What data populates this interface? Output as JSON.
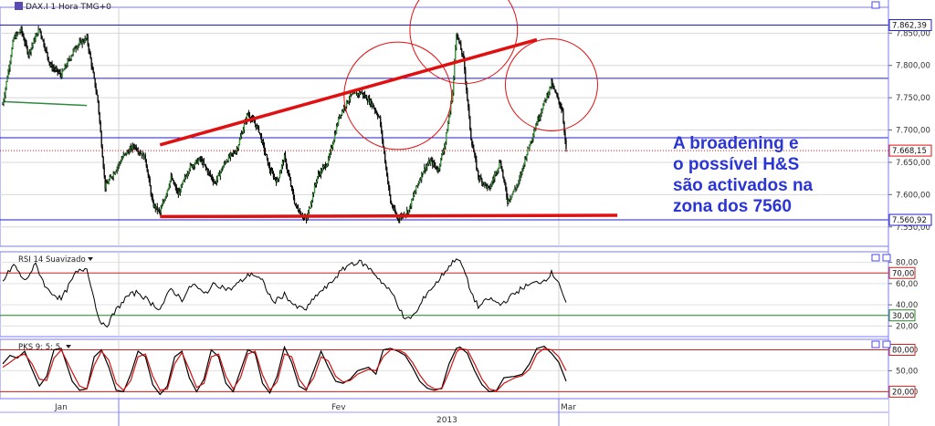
{
  "header": {
    "symbol_title": "DAX.I 1 Hora TMG+0",
    "rsi_title": "RSI 14 Suavizado",
    "pks_title": "PKS 9; 5; 5"
  },
  "annotation": {
    "lines": [
      "A broadening e",
      "o possível H&S",
      "são activados na",
      "zona dos 7560"
    ]
  },
  "colors": {
    "price": "#000000",
    "hline": "#1f1fcf",
    "trend": "#e01010",
    "current": "#e01010",
    "rsi_upper": "#cc2020",
    "rsi_lower": "#1a8a1a",
    "stoch_signal": "#d01010",
    "ma": "#2e8b3e",
    "annotation": "#2b35d6"
  },
  "chart_data": [
    {
      "type": "line",
      "title": "DAX.I 1 Hora TMG+0",
      "ylim": [
        7520,
        7890
      ],
      "yticks": [
        "7.850,00",
        "7.800,00",
        "7.750,00",
        "7.700,00",
        "7.650,00",
        "7.600,00",
        "7.550,00"
      ],
      "price_labels": [
        "7.862,39",
        "7.668,15",
        "7.560,92"
      ],
      "levels": [
        7862.39,
        7780,
        7688,
        7560.92
      ],
      "current": 7668.15,
      "x_labels": [
        "Jan",
        "Fev",
        "Mar"
      ],
      "year_label": "2013",
      "pivots": [
        [
          0,
          7740
        ],
        [
          3,
          7842
        ],
        [
          5,
          7855
        ],
        [
          7,
          7818
        ],
        [
          10,
          7857
        ],
        [
          13,
          7800
        ],
        [
          16,
          7785
        ],
        [
          20,
          7830
        ],
        [
          23,
          7842
        ],
        [
          26,
          7745
        ],
        [
          28,
          7612
        ],
        [
          31,
          7640
        ],
        [
          33,
          7660
        ],
        [
          36,
          7676
        ],
        [
          39,
          7656
        ],
        [
          41,
          7585
        ],
        [
          43,
          7572
        ],
        [
          46,
          7626
        ],
        [
          48,
          7600
        ],
        [
          51,
          7642
        ],
        [
          54,
          7655
        ],
        [
          58,
          7618
        ],
        [
          61,
          7652
        ],
        [
          64,
          7670
        ],
        [
          67,
          7726
        ],
        [
          70,
          7700
        ],
        [
          73,
          7638
        ],
        [
          75,
          7620
        ],
        [
          77,
          7658
        ],
        [
          80,
          7583
        ],
        [
          83,
          7560
        ],
        [
          86,
          7628
        ],
        [
          89,
          7652
        ],
        [
          92,
          7722
        ],
        [
          95,
          7752
        ],
        [
          98,
          7758
        ],
        [
          101,
          7740
        ],
        [
          103,
          7718
        ],
        [
          106,
          7588
        ],
        [
          108,
          7562
        ],
        [
          111,
          7576
        ],
        [
          113,
          7610
        ],
        [
          115,
          7638
        ],
        [
          117,
          7652
        ],
        [
          119,
          7638
        ],
        [
          121,
          7682
        ],
        [
          123,
          7758
        ],
        [
          124,
          7852
        ],
        [
          126,
          7808
        ],
        [
          128,
          7688
        ],
        [
          130,
          7628
        ],
        [
          133,
          7608
        ],
        [
          136,
          7652
        ],
        [
          138,
          7590
        ],
        [
          141,
          7618
        ],
        [
          143,
          7660
        ],
        [
          146,
          7712
        ],
        [
          148,
          7742
        ],
        [
          150,
          7772
        ],
        [
          151,
          7758
        ],
        [
          153,
          7730
        ],
        [
          154,
          7668
        ]
      ],
      "ma_segment": [
        [
          0,
          7744
        ],
        [
          16,
          7738
        ]
      ],
      "trendlines": [
        [
          [
            43,
            7677
          ],
          [
            146,
            7840
          ]
        ],
        [
          [
            43,
            7566
          ],
          [
            168,
            7568
          ]
        ]
      ],
      "circles": [
        {
          "center": [
            108,
            7753
          ],
          "radius": 14
        },
        {
          "center": [
            126,
            7855
          ],
          "radius": 14
        },
        {
          "center": [
            150,
            7770
          ],
          "radius": 12
        }
      ]
    },
    {
      "type": "line",
      "title": "RSI 14 Suavizado",
      "ylim": [
        10,
        90
      ],
      "yticks": [
        "80,00",
        "60,00",
        "40,00",
        "20,00"
      ],
      "levels": [
        70,
        30
      ],
      "level_labels": [
        "70,00",
        "30,00"
      ],
      "pivots": [
        [
          0,
          62
        ],
        [
          3,
          78
        ],
        [
          6,
          62
        ],
        [
          9,
          78
        ],
        [
          12,
          55
        ],
        [
          16,
          45
        ],
        [
          20,
          70
        ],
        [
          23,
          75
        ],
        [
          26,
          30
        ],
        [
          28,
          18
        ],
        [
          31,
          35
        ],
        [
          34,
          48
        ],
        [
          37,
          52
        ],
        [
          40,
          43
        ],
        [
          43,
          36
        ],
        [
          46,
          55
        ],
        [
          49,
          45
        ],
        [
          52,
          60
        ],
        [
          55,
          50
        ],
        [
          58,
          60
        ],
        [
          62,
          54
        ],
        [
          65,
          62
        ],
        [
          68,
          70
        ],
        [
          71,
          62
        ],
        [
          74,
          42
        ],
        [
          77,
          50
        ],
        [
          80,
          38
        ],
        [
          83,
          36
        ],
        [
          86,
          50
        ],
        [
          89,
          58
        ],
        [
          92,
          70
        ],
        [
          95,
          79
        ],
        [
          98,
          80
        ],
        [
          101,
          72
        ],
        [
          104,
          60
        ],
        [
          107,
          48
        ],
        [
          110,
          25
        ],
        [
          113,
          32
        ],
        [
          116,
          52
        ],
        [
          118,
          58
        ],
        [
          121,
          72
        ],
        [
          123,
          80
        ],
        [
          124,
          85
        ],
        [
          126,
          74
        ],
        [
          128,
          52
        ],
        [
          130,
          38
        ],
        [
          133,
          46
        ],
        [
          136,
          40
        ],
        [
          139,
          48
        ],
        [
          142,
          56
        ],
        [
          145,
          60
        ],
        [
          148,
          63
        ],
        [
          150,
          70
        ],
        [
          152,
          62
        ],
        [
          154,
          40
        ]
      ]
    },
    {
      "type": "line",
      "title": "PKS 9; 5; 5",
      "ylim": [
        10,
        95
      ],
      "yticks": [
        "80,00",
        "50,00",
        "20,00"
      ],
      "levels": [
        80,
        20
      ],
      "level_labels": [
        "80,00",
        "20,00"
      ],
      "series": [
        {
          "pivots": [
            [
              0,
              60
            ],
            [
              2,
              72
            ],
            [
              4,
              68
            ],
            [
              6,
              78
            ],
            [
              8,
              52
            ],
            [
              10,
              28
            ],
            [
              12,
              42
            ],
            [
              14,
              80
            ],
            [
              16,
              82
            ],
            [
              19,
              35
            ],
            [
              21,
              22
            ],
            [
              23,
              24
            ],
            [
              25,
              70
            ],
            [
              27,
              80
            ],
            [
              29,
              55
            ],
            [
              31,
              22
            ],
            [
              33,
              20
            ],
            [
              35,
              45
            ],
            [
              37,
              78
            ],
            [
              39,
              70
            ],
            [
              41,
              30
            ],
            [
              43,
              16
            ],
            [
              45,
              28
            ],
            [
              47,
              70
            ],
            [
              49,
              78
            ],
            [
              51,
              40
            ],
            [
              53,
              20
            ],
            [
              55,
              38
            ],
            [
              57,
              80
            ],
            [
              59,
              70
            ],
            [
              61,
              32
            ],
            [
              63,
              20
            ],
            [
              65,
              50
            ],
            [
              67,
              80
            ],
            [
              69,
              75
            ],
            [
              71,
              32
            ],
            [
              73,
              18
            ],
            [
              75,
              42
            ],
            [
              77,
              84
            ],
            [
              79,
              62
            ],
            [
              81,
              28
            ],
            [
              83,
              22
            ],
            [
              85,
              50
            ],
            [
              87,
              78
            ],
            [
              89,
              55
            ],
            [
              91,
              35
            ],
            [
              93,
              32
            ],
            [
              95,
              38
            ],
            [
              97,
              50
            ],
            [
              100,
              55
            ],
            [
              102,
              45
            ],
            [
              104,
              80
            ],
            [
              106,
              82
            ],
            [
              108,
              78
            ],
            [
              110,
              72
            ],
            [
              112,
              55
            ],
            [
              114,
              35
            ],
            [
              116,
              25
            ],
            [
              118,
              22
            ],
            [
              120,
              25
            ],
            [
              122,
              60
            ],
            [
              124,
              82
            ],
            [
              125,
              84
            ],
            [
              127,
              75
            ],
            [
              129,
              50
            ],
            [
              131,
              30
            ],
            [
              133,
              20
            ],
            [
              135,
              22
            ],
            [
              137,
              40
            ],
            [
              140,
              42
            ],
            [
              142,
              45
            ],
            [
              144,
              60
            ],
            [
              146,
              82
            ],
            [
              148,
              85
            ],
            [
              150,
              75
            ],
            [
              152,
              62
            ],
            [
              154,
              35
            ]
          ]
        },
        {
          "pivots": [
            [
              0,
              55
            ],
            [
              2,
              62
            ],
            [
              4,
              70
            ],
            [
              6,
              74
            ],
            [
              8,
              60
            ],
            [
              10,
              38
            ],
            [
              12,
              36
            ],
            [
              14,
              68
            ],
            [
              16,
              80
            ],
            [
              19,
              48
            ],
            [
              21,
              28
            ],
            [
              23,
              24
            ],
            [
              25,
              58
            ],
            [
              27,
              78
            ],
            [
              29,
              65
            ],
            [
              31,
              32
            ],
            [
              33,
              22
            ],
            [
              35,
              36
            ],
            [
              37,
              70
            ],
            [
              39,
              74
            ],
            [
              41,
              42
            ],
            [
              43,
              22
            ],
            [
              45,
              24
            ],
            [
              47,
              60
            ],
            [
              49,
              76
            ],
            [
              51,
              52
            ],
            [
              53,
              26
            ],
            [
              55,
              32
            ],
            [
              57,
              70
            ],
            [
              59,
              74
            ],
            [
              61,
              42
            ],
            [
              63,
              24
            ],
            [
              65,
              40
            ],
            [
              67,
              74
            ],
            [
              69,
              78
            ],
            [
              71,
              44
            ],
            [
              73,
              22
            ],
            [
              75,
              34
            ],
            [
              77,
              74
            ],
            [
              79,
              70
            ],
            [
              81,
              38
            ],
            [
              83,
              24
            ],
            [
              85,
              40
            ],
            [
              87,
              70
            ],
            [
              89,
              64
            ],
            [
              91,
              42
            ],
            [
              93,
              34
            ],
            [
              95,
              36
            ],
            [
              97,
              45
            ],
            [
              100,
              52
            ],
            [
              102,
              50
            ],
            [
              104,
              70
            ],
            [
              106,
              80
            ],
            [
              108,
              80
            ],
            [
              110,
              75
            ],
            [
              112,
              62
            ],
            [
              114,
              44
            ],
            [
              116,
              30
            ],
            [
              118,
              24
            ],
            [
              120,
              24
            ],
            [
              122,
              48
            ],
            [
              124,
              76
            ],
            [
              125,
              82
            ],
            [
              127,
              80
            ],
            [
              129,
              60
            ],
            [
              131,
              38
            ],
            [
              133,
              24
            ],
            [
              135,
              21
            ],
            [
              137,
              32
            ],
            [
              140,
              40
            ],
            [
              142,
              43
            ],
            [
              144,
              52
            ],
            [
              146,
              74
            ],
            [
              148,
              82
            ],
            [
              150,
              80
            ],
            [
              152,
              70
            ],
            [
              154,
              50
            ]
          ]
        }
      ]
    }
  ]
}
